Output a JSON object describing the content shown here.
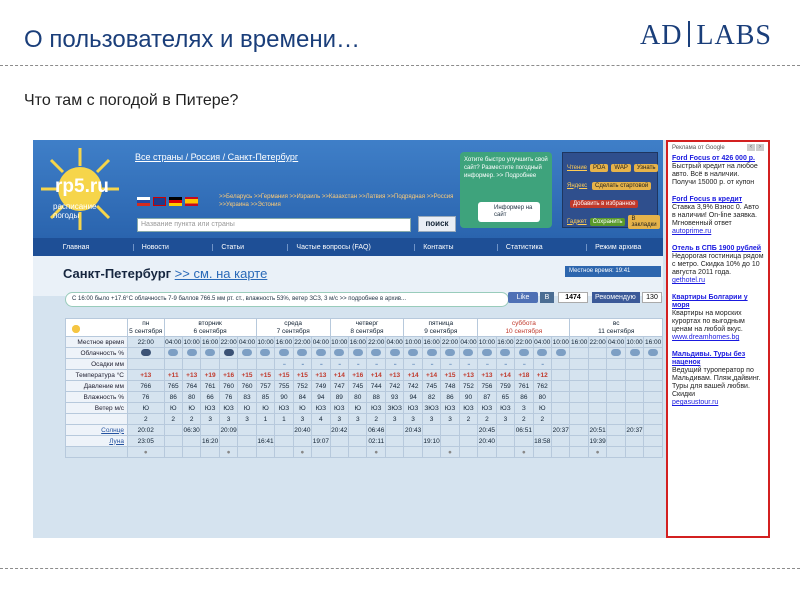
{
  "slide": {
    "title": "О пользователях и времени…",
    "logo_left": "AD",
    "logo_right": "LABS",
    "subtitle": "Что там с погодой в Питере?"
  },
  "site": {
    "logo": "rp5.ru",
    "logo_sub": "расписание погоды",
    "breadcrumb": "Все страны / Россия / Санкт-Петербург",
    "region_links": ">>Беларусь >>Германия >>Израиль >>Казахстан >>Латвия >>Подрядная >>Россия >>Украина >>Эстония",
    "search_placeholder": "Название пункта или страны",
    "search_button": "поиск",
    "promo_text": "Хотите быстро улучшить свой сайт? Разместите погодный информер. >> Подробнее",
    "widget_text": "Информер на сайт",
    "ext_links": [
      "Чтение",
      "Яндекс",
      "Гаджет"
    ],
    "ext_chips": [
      "PDA",
      "WAP",
      "Узнать",
      "Сохранить",
      "В закладки",
      "Сделать стартовой",
      "Добавить в избранное"
    ],
    "nav": [
      "Главная",
      "Новости",
      "Статьи",
      "Частые вопросы (FAQ)",
      "Контакты",
      "Статистика",
      "Режим архива"
    ],
    "city": "Санкт-Петербург",
    "map_link": ">> см. на карте",
    "local_time": "Местное время: 19:41",
    "current": "С 16:00 было +17.6°C облачность 7-9 баллов 766.5 мм рт. ст., влажность 53%, ветер ЗСЗ, 3 м/с >> подробнее в архив...",
    "social": {
      "like": "Like",
      "vk": "В",
      "count": "1474",
      "fb": "Рекомендую",
      "fb_count": "130"
    }
  },
  "forecast": {
    "days": [
      {
        "name": "пн",
        "date": "5 сентября"
      },
      {
        "name": "вторник",
        "date": "6 сентября"
      },
      {
        "name": "среда",
        "date": "7 сентября"
      },
      {
        "name": "четверг",
        "date": "8 сентября"
      },
      {
        "name": "пятница",
        "date": "9 сентября"
      },
      {
        "name": "суббота",
        "date": "10 сентября"
      },
      {
        "name": "вс",
        "date": "11 сентября"
      }
    ],
    "labels": [
      "Местное время",
      "Облачность %",
      "Осадки мм",
      "Температура °C",
      "Давление мм",
      "Влажность %",
      "Ветер м/с",
      "Солнце",
      "Луна",
      ""
    ],
    "times": [
      "22:00",
      "04:00",
      "10:00",
      "16:00",
      "22:00",
      "04:00",
      "10:00",
      "16:00",
      "22:00",
      "04:00",
      "10:00",
      "16:00",
      "22:00",
      "04:00",
      "10:00",
      "16:00",
      "22:00",
      "04:00",
      "10:00",
      "16:00",
      "22:00",
      "04:00",
      "10:00",
      "16:00",
      "22:00",
      "04:00",
      "10:00",
      "16:00"
    ],
    "temp": [
      "+13",
      "+11",
      "+13",
      "+19",
      "+16",
      "+15",
      "+15",
      "+15",
      "+15",
      "+13",
      "+14",
      "+16",
      "+14",
      "+13",
      "+14",
      "+14",
      "+15",
      "+13",
      "+13",
      "+14",
      "+18",
      "+12",
      "",
      "",
      "",
      "",
      "",
      ""
    ],
    "pressure": [
      "766",
      "765",
      "764",
      "761",
      "760",
      "760",
      "757",
      "755",
      "752",
      "749",
      "747",
      "745",
      "744",
      "742",
      "742",
      "745",
      "748",
      "752",
      "756",
      "759",
      "761",
      "762",
      "",
      "",
      "",
      "",
      "",
      ""
    ],
    "humidity": [
      "76",
      "86",
      "80",
      "66",
      "76",
      "83",
      "85",
      "90",
      "84",
      "94",
      "89",
      "80",
      "88",
      "93",
      "94",
      "82",
      "86",
      "90",
      "87",
      "65",
      "86",
      "80",
      "",
      "",
      "",
      "",
      "",
      ""
    ],
    "wind_dir": [
      "Ю",
      "Ю",
      "Ю",
      "ЮЗ",
      "ЮЗ",
      "Ю",
      "Ю",
      "ЮЗ",
      "Ю",
      "ЮЗ",
      "ЮЗ",
      "Ю",
      "ЮЗ",
      "ЗЮЗ",
      "ЮЗ",
      "ЗЮЗ",
      "ЮЗ",
      "ЮЗ",
      "ЮЗ",
      "ЮЗ",
      "З",
      "Ю",
      "",
      "",
      "",
      "",
      "",
      ""
    ],
    "wind_speed": [
      "2",
      "2",
      "2",
      "3",
      "3",
      "3",
      "1",
      "1",
      "3",
      "4",
      "3",
      "3",
      "2",
      "3",
      "3",
      "3",
      "3",
      "2",
      "2",
      "3",
      "2",
      "2",
      "",
      "",
      "",
      "",
      "",
      ""
    ],
    "sun": [
      "20:02",
      "06:30",
      "20:09",
      "",
      "20:40",
      "20:42",
      "06:46",
      "20:43",
      "",
      "20:45",
      "06:51",
      "20:37",
      "20:51",
      "20:37",
      "20:34"
    ],
    "moon": [
      "23:05",
      "16:20",
      "16:41",
      "19:07",
      "02:11",
      "19:10",
      "20:40",
      "18:58",
      "19:39"
    ]
  },
  "ads": {
    "header": "Реклама от Google",
    "items": [
      {
        "title": "Ford Focus от 426 000 р.",
        "text": "Быстрый кредит на любое авто. Всё в наличии. Получи 15000 р. от купон",
        "url": ""
      },
      {
        "title": "Ford Focus в кредит",
        "text": "Ставка 3,9% Взнос 0. Авто в наличии! On-line заявка. Мгновенный ответ",
        "url": "autoprime.ru"
      },
      {
        "title": "Отель в СПБ 1900 рублей",
        "text": "Недорогая гостиница рядом с метро. Скидка 10% до 10 августа 2011 года.",
        "url": "gethotel.ru"
      },
      {
        "title": "Квартиры Болгарии у моря",
        "text": "Квартиры на морских курортах по выгодным ценам на любой вкус.",
        "url": "www.dreamhomes.bg"
      },
      {
        "title": "Мальдивы. Туры без наценок",
        "text": "Ведущий туроператор по Мальдивам. Пляж,дайвинг. Туры для вашей любви. Скидки",
        "url": "pegasustour.ru"
      }
    ]
  },
  "colors": {
    "header_blue": "#3f7fc8",
    "nav_blue": "#1e4f96",
    "ad_border": "#d32020",
    "title_blue": "#1a3e7a"
  }
}
